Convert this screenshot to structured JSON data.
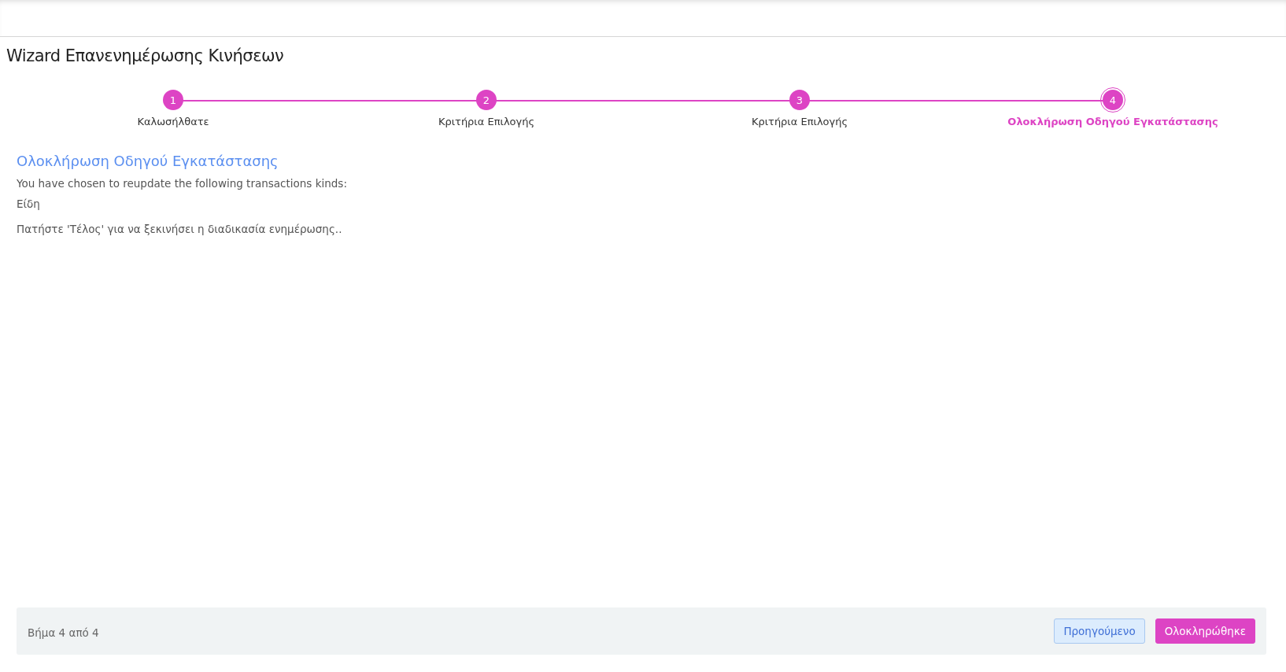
{
  "page": {
    "title": "Wizard Επανενημέρωσης Κινήσεων"
  },
  "steps": [
    {
      "number": "1",
      "label": "Καλωσήλθατε",
      "selected": false
    },
    {
      "number": "2",
      "label": "Κριτήρια Επιλογής",
      "selected": false
    },
    {
      "number": "3",
      "label": "Κριτήρια Επιλογής",
      "selected": false
    },
    {
      "number": "4",
      "label": "Ολοκλήρωση Οδηγού Εγκατάστασης",
      "selected": true
    }
  ],
  "content": {
    "heading": "Ολοκλήρωση Οδηγού Εγκατάστασης",
    "intro": "You have chosen to reupdate the following transactions kinds:",
    "kinds": [
      "Είδη"
    ],
    "note": "Πατήστε 'Τέλος' για να ξεκινήσει η διαδικασία ενημέρωσης.."
  },
  "footer": {
    "step_info": "Βήμα 4 από 4",
    "buttons": [
      {
        "label": "Προηγούμενο",
        "kind": "secondary"
      },
      {
        "label": "Ολοκληρώθηκε",
        "kind": "primary"
      }
    ]
  }
}
